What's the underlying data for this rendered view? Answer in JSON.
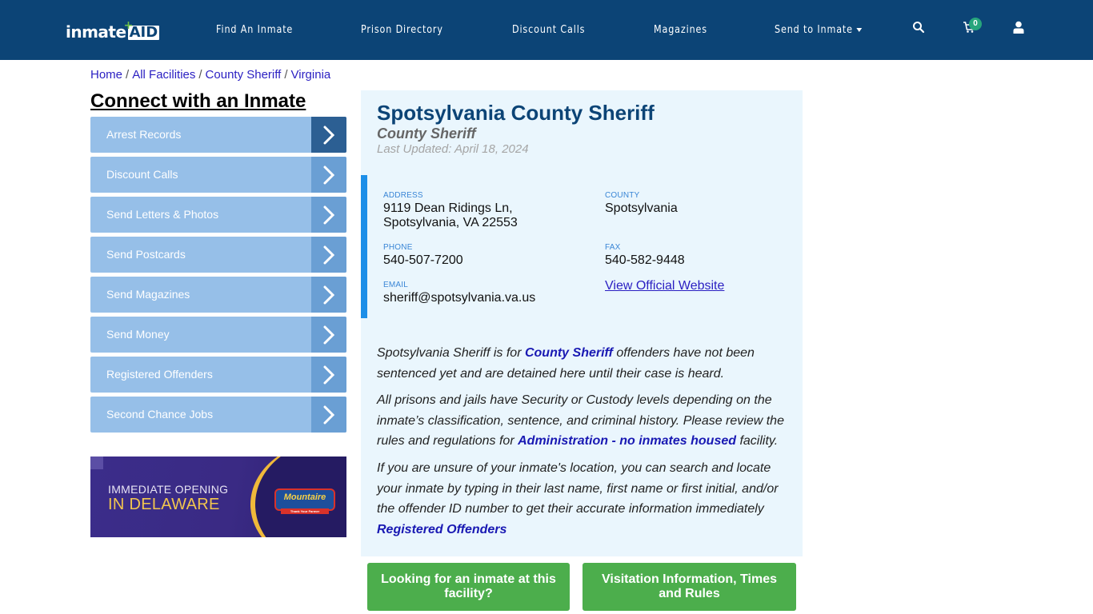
{
  "header": {
    "logo_text_1": "inmate",
    "logo_text_2": "AID",
    "nav": [
      {
        "label": "Find An Inmate"
      },
      {
        "label": "Prison Directory"
      },
      {
        "label": "Discount Calls"
      },
      {
        "label": "Magazines"
      },
      {
        "label": "Send to Inmate"
      }
    ],
    "icons": {
      "search": "search-icon",
      "cart": "cart-icon",
      "user": "user-icon"
    },
    "cart_count": "0"
  },
  "breadcrumb": [
    {
      "label": "Home"
    },
    {
      "label": "All Facilities"
    },
    {
      "label": "County Sheriff"
    },
    {
      "label": "Virginia"
    }
  ],
  "breadcrumb_separator": "/",
  "sidebar": {
    "title": "Connect with an Inmate",
    "items": [
      {
        "label": "Arrest Records"
      },
      {
        "label": "Discount Calls"
      },
      {
        "label": "Send Letters & Photos"
      },
      {
        "label": "Send Postcards"
      },
      {
        "label": "Send Magazines"
      },
      {
        "label": "Send Money"
      },
      {
        "label": "Registered Offenders"
      },
      {
        "label": "Second Chance Jobs"
      }
    ],
    "ad": {
      "line1": "IMMEDIATE OPENING",
      "line2": "IN DELAWARE",
      "brand": "Mountaire",
      "brand_tagline": "Thank Your Farmer"
    }
  },
  "facility": {
    "name": "Spotsylvania County Sheriff",
    "type": "County Sheriff",
    "last_updated": "Last Updated: April 18, 2024",
    "address_label": "ADDRESS",
    "address_line1": "9119 Dean Ridings Ln,",
    "address_line2": "Spotsylvania, VA 22553",
    "county_label": "COUNTY",
    "county": "Spotsylvania",
    "phone_label": "PHONE",
    "phone": "540-507-7200",
    "fax_label": "FAX",
    "fax": "540-582-9448",
    "email_label": "EMAIL",
    "email": "sheriff@spotsylvania.va.us",
    "website_link": "View Official Website"
  },
  "description": {
    "p1_a": "Spotsylvania Sheriff is for ",
    "p1_link": "County Sheriff",
    "p1_b": " offenders have not been sentenced yet and are detained here until their case is heard.",
    "p2_a": "All prisons and jails have Security or Custody levels depending on the inmate’s classification, sentence, and criminal history. Please review the rules and regulations for ",
    "p2_link": "Administration - no inmates housed",
    "p2_b": " facility.",
    "p3": "If you are unsure of your inmate's location, you can search and locate your inmate by typing in their last name, first name or first initial, and/or the offender ID number to get their accurate information immediately",
    "p3_link": "Registered Offenders"
  },
  "buttons": {
    "find_inmate": "Looking for an inmate at this facility?",
    "visitation": "Visitation Information, Times and Rules"
  },
  "colors": {
    "navbar": "#0c4476",
    "sidebar_item": "#96bfe8",
    "sidebar_arrow": "#6a9fd4",
    "sidebar_arrow_active": "#2c5f93",
    "panel_bg": "#eaf6fd",
    "accent_bar": "#1d8fe8",
    "green_button": "#4cae4c",
    "link": "#1919b3"
  }
}
